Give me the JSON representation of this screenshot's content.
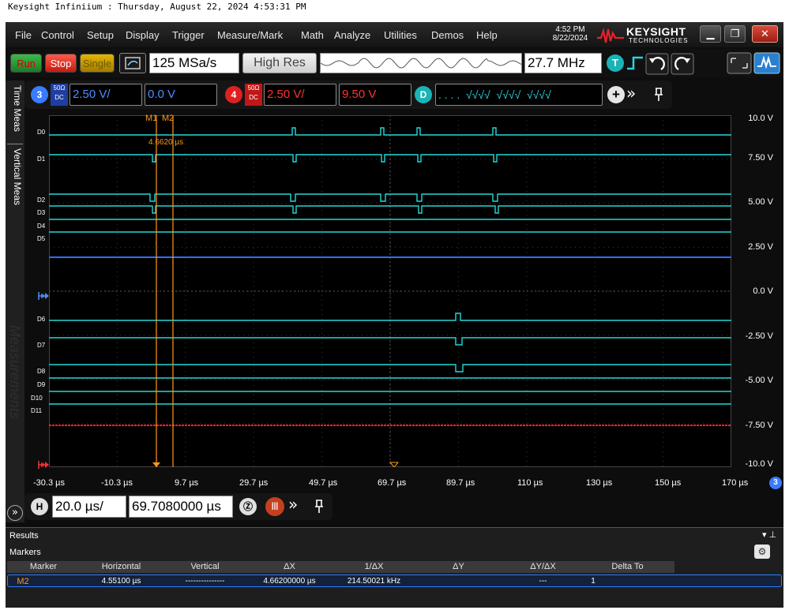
{
  "window_caption": "Keysight Infiniium : Thursday, August 22, 2024 4:53:31 PM",
  "menu": [
    "File",
    "Control",
    "Setup",
    "Display",
    "Trigger",
    "Measure/Mark",
    "Math",
    "Analyze",
    "Utilities",
    "Demos",
    "Help"
  ],
  "clock": {
    "time": "4:52 PM",
    "date": "8/22/2024"
  },
  "logo": {
    "brand": "KEYSIGHT",
    "sub": "TECHNOLOGIES"
  },
  "toolbar": {
    "run": "Run",
    "stop": "Stop",
    "single": "Single",
    "sample_rate": "125 MSa/s",
    "acq_mode": "High Res",
    "bandwidth": "27.7 MHz",
    "trigger_badge": "T"
  },
  "channels": {
    "ch3": {
      "badge": "3",
      "coupling_top": "50Ω",
      "coupling_bottom": "DC",
      "scale": "2.50 V/",
      "offset": "0.0 V",
      "color": "#3a7bff"
    },
    "ch4": {
      "badge": "4",
      "coupling_top": "50Ω",
      "coupling_bottom": "DC",
      "scale": "2.50 V/",
      "offset": "9.50 V",
      "color": "#ff2020"
    },
    "digital": {
      "badge": "D",
      "pattern": ". . . .  √√√√  √√√√  √√√√"
    }
  },
  "side_tabs": [
    "Time Meas",
    "Vertical Meas"
  ],
  "watermark": "Measurements",
  "markers_overlay": {
    "m1": "M1",
    "m2": "M2",
    "delta": "4.6620 µs"
  },
  "digital_labels": [
    "D0",
    "D1",
    "D2",
    "D3",
    "D4",
    "D5",
    "D6",
    "D7",
    "D8",
    "D9",
    "D10",
    "D11"
  ],
  "v_axis": [
    "10.0 V",
    "7.50 V",
    "5.00 V",
    "2.50 V",
    "0.0 V",
    "-2.50 V",
    "-5.00 V",
    "-7.50 V",
    "-10.0 V"
  ],
  "t_axis": [
    "-30.3 µs",
    "-10.3 µs",
    "9.7 µs",
    "29.7 µs",
    "49.7 µs",
    "69.7 µs",
    "89.7 µs",
    "110 µs",
    "130 µs",
    "150 µs",
    "170 µs"
  ],
  "t_axis_badge": "3",
  "horizontal": {
    "badge": "H",
    "scale": "20.0 µs/",
    "position": "69.7080000 µs"
  },
  "results": {
    "title": "Results",
    "section": "Markers",
    "columns": [
      "Marker",
      "Horizontal",
      "Vertical",
      "ΔX",
      "1/ΔX",
      "ΔY",
      "ΔY/ΔX",
      "Delta To"
    ],
    "rows": [
      [
        "M2",
        "4.55100 µs",
        "---------------",
        "4.66200000 µs",
        "214.50021 kHz",
        "",
        "---",
        "1"
      ]
    ]
  },
  "colors": {
    "digital_trace": "#22d8d8",
    "ch3_trace": "#2f6fff",
    "ch4_trace": "#ff2a2a",
    "marker": "#ff9a1a"
  }
}
